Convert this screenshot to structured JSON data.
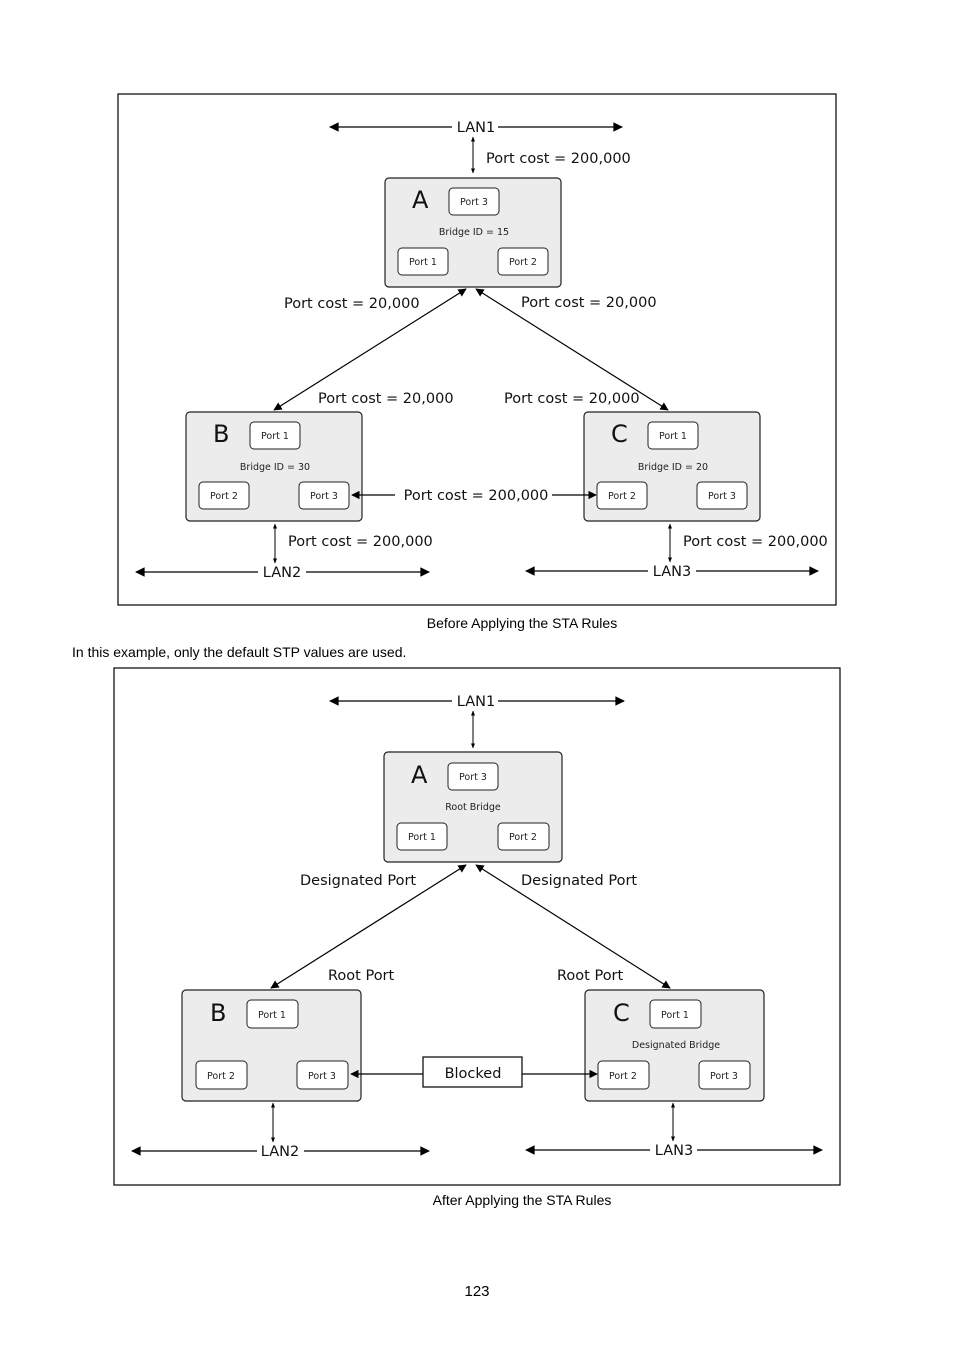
{
  "figure1": {
    "caption": "Before Applying the STA Rules",
    "lans": {
      "lan1": "LAN1",
      "lan2": "LAN2",
      "lan3": "LAN3"
    },
    "bridges": {
      "a": {
        "letter": "A",
        "info": "Bridge ID = 15",
        "port_top": "Port 3",
        "port_left": "Port 1",
        "port_right": "Port 2"
      },
      "b": {
        "letter": "B",
        "info": "Bridge ID = 30",
        "port_top": "Port 1",
        "port_left": "Port 2",
        "port_right": "Port 3"
      },
      "c": {
        "letter": "C",
        "info": "Bridge ID = 20",
        "port_top": "Port 1",
        "port_left": "Port 2",
        "port_right": "Port 3"
      }
    },
    "labels": {
      "lan1_a": "Port cost = 200,000",
      "a_left": "Port cost = 20,000",
      "a_right": "Port cost = 20,000",
      "b_top": "Port cost = 20,000",
      "c_top": "Port cost = 20,000",
      "b_c": "Port cost = 200,000",
      "b_lan2": "Port cost = 200,000",
      "c_lan3": "Port cost = 200,000"
    }
  },
  "body_text": "In this example, only the default STP values are used.",
  "figure2": {
    "caption": "After Applying the STA Rules",
    "lans": {
      "lan1": "LAN1",
      "lan2": "LAN2",
      "lan3": "LAN3"
    },
    "bridges": {
      "a": {
        "letter": "A",
        "info": "Root Bridge",
        "port_top": "Port 3",
        "port_left": "Port 1",
        "port_right": "Port 2"
      },
      "b": {
        "letter": "B",
        "info": "",
        "port_top": "Port 1",
        "port_left": "Port 2",
        "port_right": "Port 3"
      },
      "c": {
        "letter": "C",
        "info": "Designated Bridge",
        "port_top": "Port 1",
        "port_left": "Port 2",
        "port_right": "Port 3"
      }
    },
    "labels": {
      "a_left": "Designated Port",
      "a_right": "Designated Port",
      "b_top": "Root Port",
      "c_top": "Root Port",
      "blocked": "Blocked"
    }
  },
  "page_number": "123"
}
